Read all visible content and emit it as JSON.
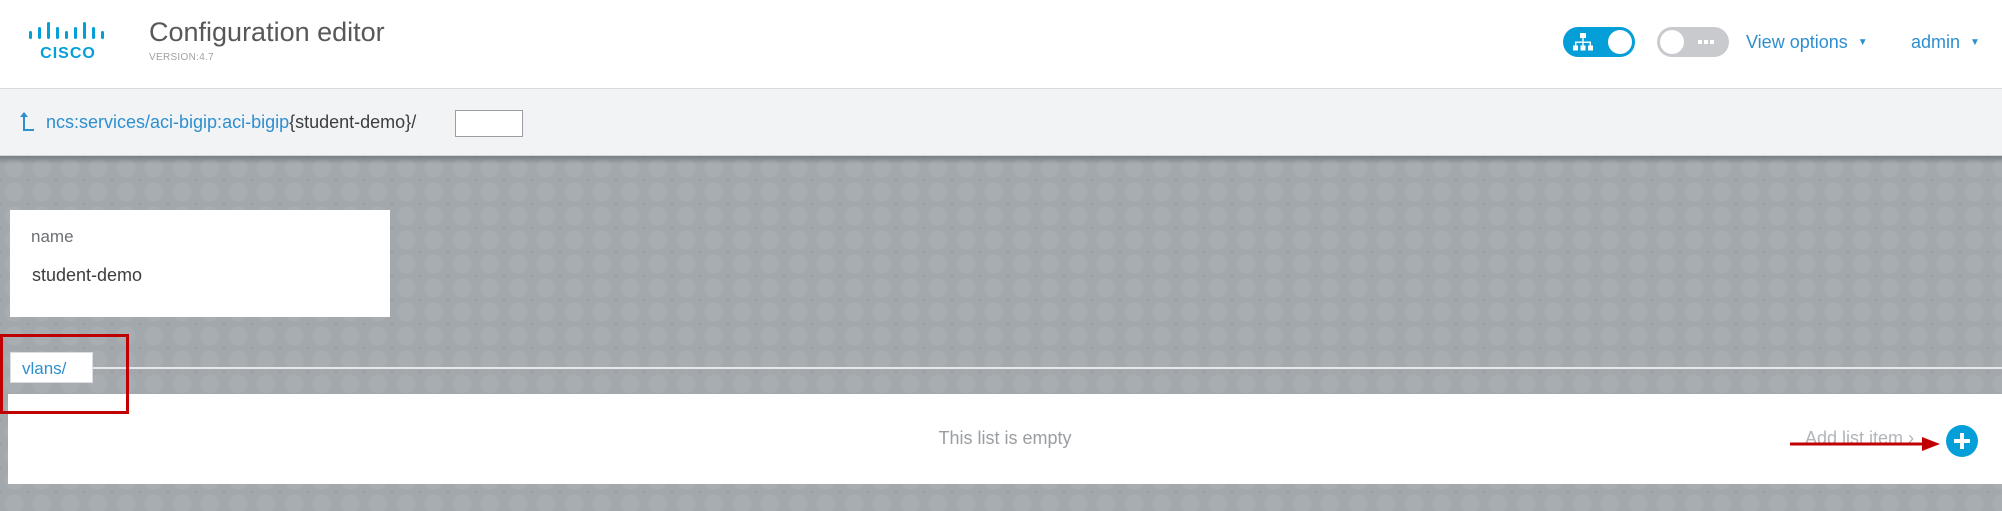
{
  "header": {
    "brand": "CISCO",
    "title": "Configuration editor",
    "version": "VERSION:4.7",
    "toggles": [
      {
        "name": "tree-view-toggle",
        "state": "on",
        "icon": "hierarchy-icon"
      },
      {
        "name": "more-toggle",
        "state": "off",
        "icon": "ellipsis-icon"
      }
    ],
    "view_options_label": "View options",
    "user_label": "admin"
  },
  "breadcrumb": {
    "up_icon": "arrow-up-icon",
    "path": "ncs:services/aci-bigip:aci-bigip",
    "key": "{student-demo}",
    "separator": "/",
    "input_value": ""
  },
  "record": {
    "field_label": "name",
    "field_value": "student-demo"
  },
  "list": {
    "tab_label": "vlans/",
    "empty_message": "This list is empty",
    "add_label": "Add list item",
    "add_icon": "plus-circle-icon"
  },
  "colors": {
    "accent": "#049fd9",
    "link": "#2e8fd0",
    "annotation": "#c00000"
  }
}
